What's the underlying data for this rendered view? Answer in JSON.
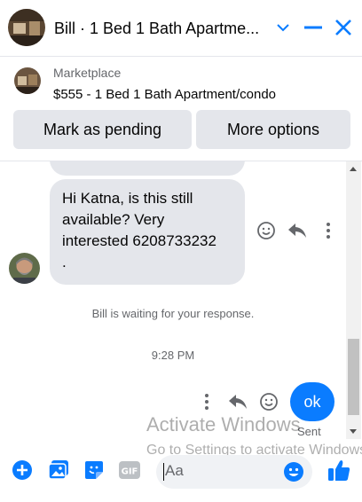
{
  "header": {
    "title": "Bill · 1 Bed 1 Bath Apartme...",
    "icons": [
      "chevron-down-icon",
      "minimize-icon",
      "close-icon"
    ]
  },
  "marketplace": {
    "label": "Marketplace",
    "listing": "$555 - 1 Bed 1 Bath Apartment/condo",
    "buttons": {
      "pending": "Mark as pending",
      "more": "More options"
    }
  },
  "chat": {
    "message_lines": [
      "Hi Katna, is this still",
      "available? Very",
      "interested 6208733232",
      "."
    ],
    "system_note": "Bill is waiting for your response.",
    "time": "9:28 PM",
    "outgoing": "ok",
    "status": "Sent"
  },
  "watermark": {
    "title": "Activate Windows",
    "subtitle": "Go to Settings to activate Windows."
  },
  "composer": {
    "placeholder": "Aa",
    "icons": [
      "plus-icon",
      "photo-icon",
      "sticker-icon",
      "gif-icon",
      "emoji-icon",
      "like-icon"
    ],
    "gif_label": "GIF"
  },
  "colors": {
    "accent": "#0a7cff",
    "bubble_gray": "#e4e6eb",
    "secondary_text": "#65676b"
  }
}
